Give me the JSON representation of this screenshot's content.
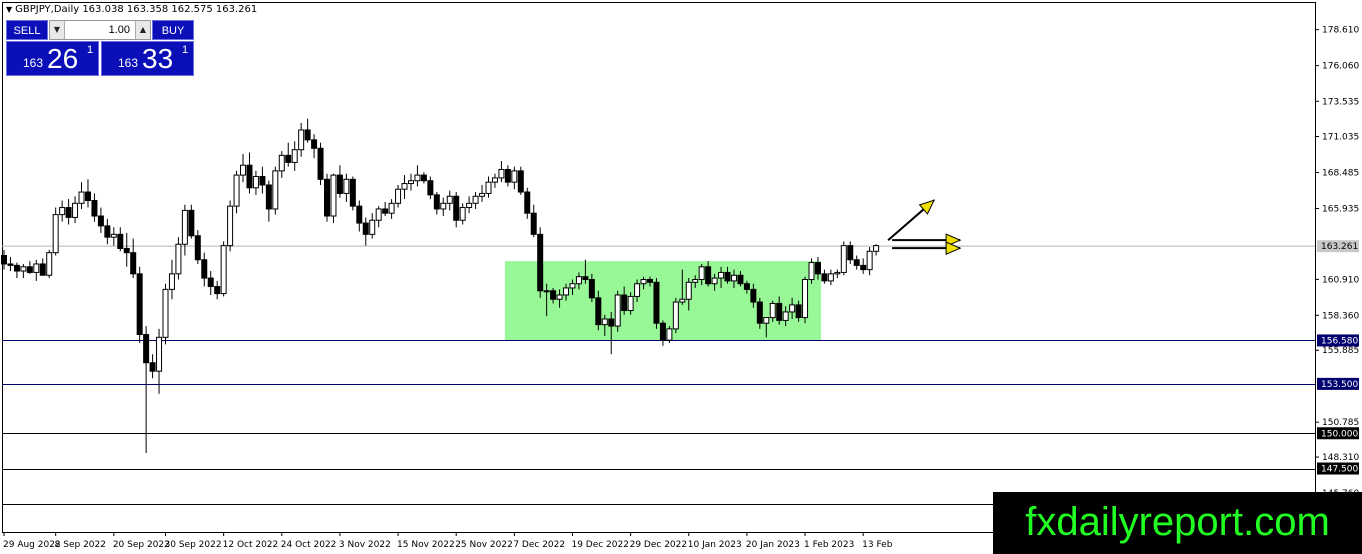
{
  "header": {
    "symbol_line": "GBPJPY,Daily  163.038 163.358 162.575 163.261"
  },
  "trade_panel": {
    "sell_label": "SELL",
    "buy_label": "BUY",
    "lot_value": "1.00",
    "sell_small": "163",
    "sell_big": "26",
    "sell_sup": "1",
    "buy_small": "163",
    "buy_big": "33",
    "buy_sup": "1"
  },
  "watermark": "fxdailyreport.com",
  "colors": {
    "accent_blue": "#0b0fb8",
    "range_box": "#98f898",
    "arrow_yellow": "#f0e000",
    "watermark_green": "#22ff22",
    "hline_navy": "#00006e"
  },
  "chart_data": {
    "type": "candlestick",
    "title": "GBPJPY,Daily",
    "ohlc_header": [
      163.038,
      163.358,
      162.575,
      163.261
    ],
    "price_ticks": [
      "178.610",
      "176.060",
      "173.535",
      "171.035",
      "168.485",
      "165.935",
      "160.910",
      "158.360",
      "155.885",
      "150.785",
      "148.310",
      "145.760"
    ],
    "date_ticks": [
      "29 Aug 2022",
      "8 Sep 2022",
      "20 Sep 2022",
      "30 Sep 2022",
      "12 Oct 2022",
      "24 Oct 2022",
      "3 Nov 2022",
      "15 Nov 2022",
      "25 Nov 2022",
      "7 Dec 2022",
      "19 Dec 2022",
      "29 Dec 2022",
      "10 Jan 2023",
      "20 Jan 2023",
      "1 Feb 2023",
      "13 Feb"
    ],
    "current_price": "163.261",
    "horizontal_levels": [
      {
        "value": "156.580",
        "label": "156.580",
        "style": "blue"
      },
      {
        "value": "153.500",
        "label": "153.500",
        "style": "blue"
      },
      {
        "value": "150.000",
        "label": "150.000",
        "style": "dark"
      },
      {
        "value": "147.500",
        "label": "147.500",
        "style": "dark"
      },
      {
        "value": "145.000",
        "label": "145.000",
        "style": "dark"
      }
    ],
    "range_zone": {
      "from_date_index": 78,
      "to_date_index": 126,
      "low": 156.6,
      "high": 162.2
    },
    "ylim": [
      143.0,
      180.5
    ],
    "candles": [
      [
        162.6,
        163.0,
        161.6,
        162.0
      ],
      [
        162.0,
        162.5,
        161.5,
        161.9
      ],
      [
        161.9,
        162.1,
        161.0,
        161.5
      ],
      [
        161.5,
        162.0,
        161.0,
        161.8
      ],
      [
        161.8,
        162.2,
        161.3,
        161.4
      ],
      [
        161.4,
        162.3,
        160.8,
        162.0
      ],
      [
        162.0,
        162.4,
        161.2,
        161.2
      ],
      [
        161.2,
        163.0,
        161.0,
        162.8
      ],
      [
        162.8,
        166.0,
        162.6,
        165.5
      ],
      [
        165.5,
        166.5,
        165.0,
        166.0
      ],
      [
        166.0,
        166.6,
        164.8,
        165.3
      ],
      [
        165.3,
        166.8,
        164.9,
        166.3
      ],
      [
        166.3,
        167.8,
        165.9,
        167.1
      ],
      [
        167.1,
        168.0,
        166.0,
        166.5
      ],
      [
        166.5,
        167.0,
        165.0,
        165.4
      ],
      [
        165.4,
        166.0,
        164.2,
        164.7
      ],
      [
        164.7,
        165.2,
        163.4,
        163.9
      ],
      [
        163.9,
        164.6,
        163.3,
        164.1
      ],
      [
        164.1,
        164.6,
        162.9,
        163.1
      ],
      [
        163.1,
        164.2,
        161.8,
        162.8
      ],
      [
        162.8,
        163.8,
        161.0,
        161.3
      ],
      [
        161.3,
        161.8,
        156.4,
        157.0
      ],
      [
        157.0,
        157.6,
        148.6,
        155.0
      ],
      [
        155.0,
        155.6,
        153.9,
        154.4
      ],
      [
        154.4,
        157.4,
        152.8,
        156.8
      ],
      [
        156.8,
        160.6,
        156.3,
        160.2
      ],
      [
        160.2,
        162.3,
        159.5,
        161.3
      ],
      [
        161.3,
        163.9,
        160.9,
        163.4
      ],
      [
        163.4,
        166.2,
        162.6,
        165.8
      ],
      [
        165.8,
        166.2,
        163.8,
        164.0
      ],
      [
        164.0,
        164.4,
        162.0,
        162.3
      ],
      [
        162.3,
        162.8,
        160.4,
        161.0
      ],
      [
        161.0,
        161.5,
        159.8,
        160.4
      ],
      [
        160.4,
        160.8,
        159.5,
        159.9
      ],
      [
        159.9,
        163.6,
        159.7,
        163.3
      ],
      [
        163.3,
        166.5,
        162.9,
        166.1
      ],
      [
        166.1,
        168.6,
        165.6,
        168.3
      ],
      [
        168.3,
        169.8,
        167.8,
        169.0
      ],
      [
        169.0,
        169.9,
        167.0,
        167.4
      ],
      [
        167.4,
        168.6,
        166.9,
        168.2
      ],
      [
        168.2,
        168.9,
        167.0,
        167.6
      ],
      [
        167.6,
        167.9,
        165.0,
        165.9
      ],
      [
        165.9,
        168.9,
        165.5,
        168.6
      ],
      [
        168.6,
        170.0,
        168.1,
        169.7
      ],
      [
        169.7,
        170.6,
        168.9,
        169.2
      ],
      [
        169.2,
        170.7,
        168.6,
        170.1
      ],
      [
        170.1,
        172.0,
        169.6,
        171.5
      ],
      [
        171.5,
        172.3,
        170.6,
        170.8
      ],
      [
        170.8,
        171.2,
        169.5,
        170.2
      ],
      [
        170.2,
        170.6,
        167.6,
        168.0
      ],
      [
        168.0,
        168.4,
        165.0,
        165.4
      ],
      [
        165.4,
        168.4,
        164.9,
        168.3
      ],
      [
        168.3,
        169.0,
        166.7,
        167.0
      ],
      [
        167.0,
        168.4,
        166.4,
        168.0
      ],
      [
        168.0,
        168.2,
        165.8,
        166.1
      ],
      [
        166.1,
        166.5,
        164.3,
        164.9
      ],
      [
        164.9,
        165.3,
        163.3,
        164.1
      ],
      [
        164.1,
        165.6,
        163.8,
        165.1
      ],
      [
        165.1,
        166.1,
        164.6,
        165.9
      ],
      [
        165.9,
        166.4,
        165.4,
        165.6
      ],
      [
        165.6,
        166.6,
        165.2,
        166.3
      ],
      [
        166.3,
        167.6,
        166.0,
        167.3
      ],
      [
        167.3,
        168.3,
        166.6,
        167.7
      ],
      [
        167.7,
        168.4,
        167.2,
        167.9
      ],
      [
        167.9,
        169.0,
        167.5,
        168.3
      ],
      [
        168.3,
        168.5,
        167.7,
        167.9
      ],
      [
        167.9,
        168.2,
        166.6,
        166.9
      ],
      [
        166.9,
        167.1,
        165.5,
        165.9
      ],
      [
        165.9,
        166.7,
        165.4,
        166.3
      ],
      [
        166.3,
        167.2,
        165.8,
        166.8
      ],
      [
        166.8,
        167.1,
        164.6,
        165.1
      ],
      [
        165.1,
        166.3,
        164.8,
        166.0
      ],
      [
        166.0,
        166.8,
        165.6,
        166.3
      ],
      [
        166.3,
        167.1,
        165.9,
        166.8
      ],
      [
        166.8,
        167.6,
        166.4,
        167.0
      ],
      [
        167.0,
        168.2,
        166.7,
        167.8
      ],
      [
        167.8,
        168.4,
        167.4,
        168.1
      ],
      [
        168.1,
        169.3,
        167.8,
        168.7
      ],
      [
        168.7,
        169.0,
        167.5,
        167.8
      ],
      [
        167.8,
        168.9,
        167.3,
        168.6
      ],
      [
        168.6,
        168.9,
        166.9,
        167.1
      ],
      [
        167.1,
        167.4,
        165.2,
        165.6
      ],
      [
        165.6,
        166.2,
        163.9,
        164.1
      ],
      [
        164.1,
        164.6,
        159.6,
        160.1
      ],
      [
        160.1,
        160.6,
        158.3,
        160.1
      ],
      [
        160.1,
        160.3,
        159.2,
        159.5
      ],
      [
        159.5,
        160.2,
        158.9,
        159.8
      ],
      [
        159.8,
        160.6,
        159.4,
        160.3
      ],
      [
        160.3,
        160.9,
        159.8,
        160.6
      ],
      [
        160.6,
        161.4,
        160.2,
        161.1
      ],
      [
        161.1,
        162.3,
        160.6,
        160.9
      ],
      [
        160.9,
        161.3,
        159.3,
        159.6
      ],
      [
        159.6,
        160.1,
        157.3,
        157.7
      ],
      [
        157.7,
        158.4,
        156.9,
        158.1
      ],
      [
        158.1,
        158.6,
        155.6,
        157.6
      ],
      [
        157.6,
        160.1,
        157.2,
        159.8
      ],
      [
        159.8,
        160.4,
        158.4,
        158.7
      ],
      [
        158.7,
        160.0,
        158.4,
        159.7
      ],
      [
        159.7,
        160.9,
        159.3,
        160.6
      ],
      [
        160.6,
        161.1,
        160.2,
        160.9
      ],
      [
        160.9,
        161.1,
        160.4,
        160.7
      ],
      [
        160.7,
        161.0,
        157.4,
        157.8
      ],
      [
        157.8,
        158.0,
        156.2,
        156.6
      ],
      [
        156.6,
        157.6,
        156.4,
        157.4
      ],
      [
        157.4,
        159.6,
        157.1,
        159.3
      ],
      [
        159.3,
        161.6,
        159.1,
        159.5
      ],
      [
        159.5,
        161.0,
        158.7,
        160.7
      ],
      [
        160.7,
        161.2,
        160.3,
        160.9
      ],
      [
        160.9,
        162.0,
        160.5,
        161.8
      ],
      [
        161.8,
        162.2,
        160.4,
        160.6
      ],
      [
        160.6,
        161.3,
        160.1,
        161.0
      ],
      [
        161.0,
        161.8,
        160.3,
        161.4
      ],
      [
        161.4,
        161.8,
        160.6,
        160.8
      ],
      [
        160.8,
        161.6,
        160.3,
        161.2
      ],
      [
        161.2,
        161.5,
        160.4,
        160.6
      ],
      [
        160.6,
        160.8,
        159.9,
        160.2
      ],
      [
        160.2,
        160.6,
        158.9,
        159.3
      ],
      [
        159.3,
        159.6,
        157.4,
        157.8
      ],
      [
        157.8,
        158.2,
        156.8,
        158.2
      ],
      [
        158.2,
        159.4,
        157.9,
        159.2
      ],
      [
        159.2,
        159.7,
        157.7,
        158.0
      ],
      [
        158.0,
        159.0,
        157.6,
        158.6
      ],
      [
        158.6,
        159.6,
        158.1,
        159.1
      ],
      [
        159.1,
        159.4,
        157.9,
        158.2
      ],
      [
        158.2,
        161.1,
        157.8,
        160.9
      ],
      [
        160.9,
        162.4,
        160.6,
        162.1
      ],
      [
        162.1,
        162.5,
        160.9,
        161.3
      ],
      [
        161.3,
        161.6,
        160.6,
        160.8
      ],
      [
        160.8,
        161.6,
        160.5,
        161.3
      ],
      [
        161.3,
        161.6,
        161.0,
        161.4
      ],
      [
        161.4,
        163.6,
        161.2,
        163.3
      ],
      [
        163.3,
        163.6,
        162.0,
        162.3
      ],
      [
        162.3,
        162.6,
        161.6,
        161.9
      ],
      [
        161.9,
        162.4,
        161.3,
        161.6
      ],
      [
        161.6,
        163.2,
        161.2,
        162.9
      ],
      [
        162.9,
        163.4,
        162.6,
        163.3
      ]
    ],
    "annotations": [
      {
        "type": "arrow",
        "direction": "up-right",
        "color": "yellow"
      },
      {
        "type": "arrow",
        "direction": "right",
        "color": "yellow"
      },
      {
        "type": "arrow",
        "direction": "right",
        "color": "yellow"
      }
    ]
  }
}
